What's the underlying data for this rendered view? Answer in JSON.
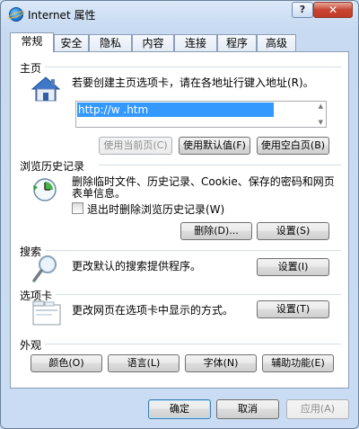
{
  "window": {
    "title": "Internet 属性",
    "help_label": "?",
    "close_label": "✕"
  },
  "tabs": [
    {
      "label": "常规",
      "active": true
    },
    {
      "label": "安全"
    },
    {
      "label": "隐私"
    },
    {
      "label": "内容"
    },
    {
      "label": "连接"
    },
    {
      "label": "程序"
    },
    {
      "label": "高级"
    }
  ],
  "home": {
    "section_label": "主页",
    "description": "若要创建主页选项卡，请在各地址行键入地址(R)。",
    "url_value": "http://w                              .htm",
    "buttons": {
      "use_current": "使用当前页(C)",
      "use_default": "使用默认值(F)",
      "use_blank": "使用空白页(B)"
    }
  },
  "history": {
    "section_label": "浏览历史记录",
    "description_line1": "删除临时文件、历史记录、Cookie、保存的密码和网页",
    "description_line2": "表单信息。",
    "checkbox_label": "退出时删除浏览历史记录(W)",
    "checkbox_checked": false,
    "buttons": {
      "delete": "删除(D)...",
      "settings": "设置(S)"
    }
  },
  "search": {
    "section_label": "搜索",
    "description": "更改默认的搜索提供程序。",
    "settings_button": "设置(I)"
  },
  "tabs_section": {
    "section_label": "选项卡",
    "description": "更改网页在选项卡中显示的方式。",
    "settings_button": "设置(T)"
  },
  "appearance": {
    "section_label": "外观",
    "buttons": {
      "colors": "颜色(O)",
      "languages": "语言(L)",
      "fonts": "字体(N)",
      "accessibility": "辅助功能(E)"
    }
  },
  "footer": {
    "ok": "确定",
    "cancel": "取消",
    "apply": "应用(A)"
  },
  "colors": {
    "selection": "#3399ff",
    "panel_border": "#8c9db5",
    "close_button": "#c84532"
  }
}
